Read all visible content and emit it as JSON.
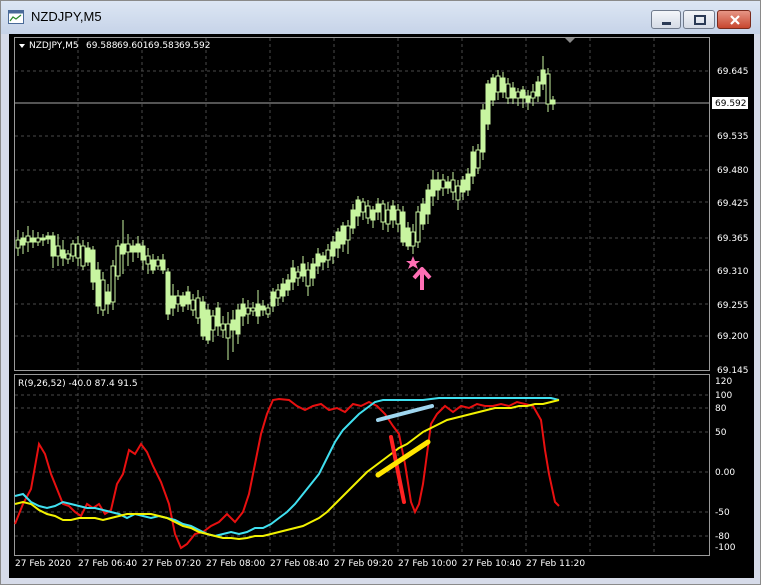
{
  "window": {
    "title": "NZDJPY,M5"
  },
  "main_panel": {
    "symbol": "NZDJPY,M5",
    "open": "69.588",
    "high": "69.601",
    "low": "69.583",
    "close": "69.592",
    "current_price_label": "69.592",
    "price_ticks": [
      "69.645",
      "69.592",
      "69.535",
      "69.480",
      "69.425",
      "69.365",
      "69.310",
      "69.255",
      "69.200",
      "69.145"
    ]
  },
  "indicator_panel": {
    "label": "R(9,26,52) -40.0 87.4 91.5",
    "ticks": [
      "120",
      "100",
      "80",
      "50",
      "0.00",
      "-50",
      "-80",
      "-100"
    ]
  },
  "time_axis": [
    "27 Feb 2020",
    "27 Feb 06:40",
    "27 Feb 07:20",
    "27 Feb 08:00",
    "27 Feb 08:40",
    "27 Feb 09:20",
    "27 Feb 10:00",
    "27 Feb 10:40",
    "27 Feb 11:20"
  ],
  "annotations": {
    "star_color": "#ff6fb5",
    "arrow_color": "#ff6fb5",
    "arrow_direction": "up"
  },
  "colors": {
    "background": "#000000",
    "grid": "#4a4a4a",
    "candles": "#c8f5a0",
    "line_red": "#e81010",
    "line_cyan": "#40e0f0",
    "line_yellow": "#f2f200",
    "mark_lightblue": "#9fd6ef",
    "mark_red": "#ff2222",
    "mark_yellow": "#ffe600"
  },
  "chart_data": {
    "type": "candlestick",
    "price_range": [
      69.145,
      69.68
    ],
    "candles_close_path": [
      69.35,
      69.35,
      69.36,
      69.34,
      69.33,
      69.36,
      69.37,
      69.34,
      69.3,
      69.26,
      69.24,
      69.22,
      69.24,
      69.22,
      69.24,
      69.26,
      69.25,
      69.27,
      69.3,
      69.3,
      69.33,
      69.35,
      69.38,
      69.4,
      69.43,
      69.4,
      69.37,
      69.34,
      69.38,
      69.42,
      69.45,
      69.47,
      69.5,
      69.55,
      69.6,
      69.64,
      69.62,
      69.61,
      69.64,
      69.59
    ]
  }
}
